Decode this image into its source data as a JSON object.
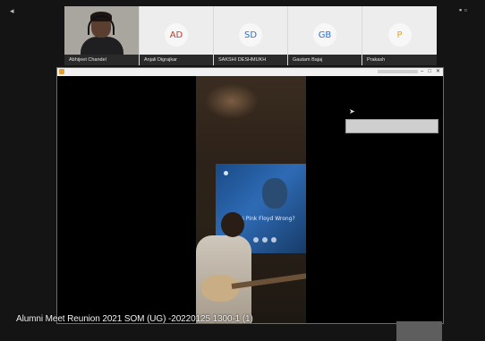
{
  "participants": [
    {
      "name": "Abhijeet Chandel",
      "type": "video",
      "initials": ""
    },
    {
      "name": "Anjali Digrajkar",
      "type": "avatar",
      "initials": "AD",
      "color": "#c0392b"
    },
    {
      "name": "SAKSHI DESHMUKH",
      "type": "avatar",
      "initials": "SD",
      "color": "#2f6fcf"
    },
    {
      "name": "Gautam Bajaj",
      "type": "avatar",
      "initials": "GB",
      "color": "#2f6fcf"
    },
    {
      "name": "Prakash",
      "type": "avatar",
      "initials": "P",
      "color": "#e0a13a"
    }
  ],
  "shared_window": {
    "controls": [
      "–",
      "□",
      "✕"
    ],
    "tv_text": "Is Pink Floyd Wrong?"
  },
  "meeting_title": "Alumni Meet Reunion 2021 SOM (UG) -20220125 1300-1 (1)",
  "icons": {
    "top_left": "pin-icon",
    "top_right": "window-controls-icon",
    "app": "app-icon",
    "cursor": "mouse-pointer-icon"
  }
}
